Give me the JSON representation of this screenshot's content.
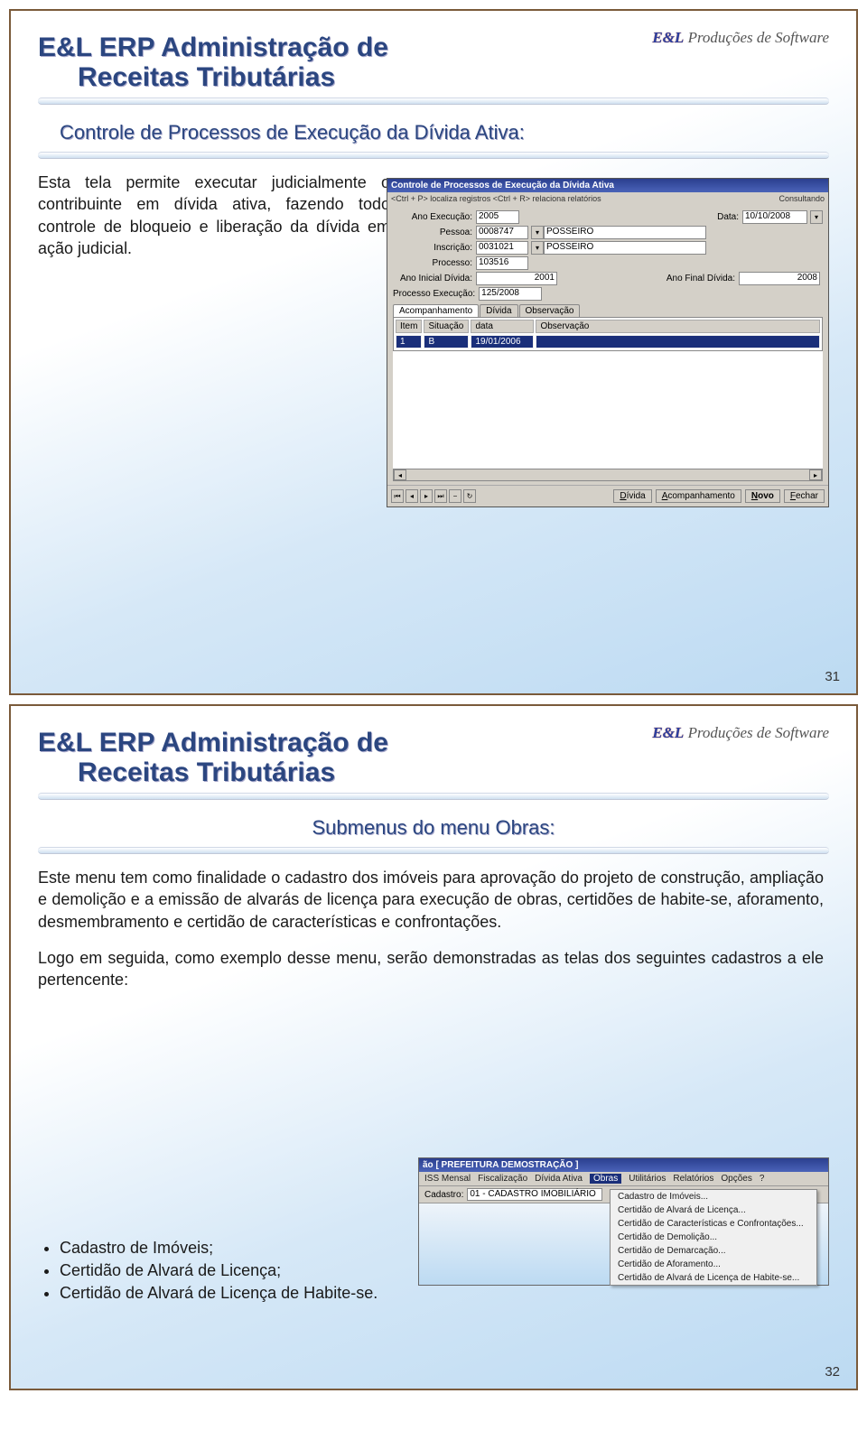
{
  "brand": {
    "el": "E&L",
    "tagline": "Produções de Software"
  },
  "slide1": {
    "title_l1": "E&L ERP Administração de",
    "title_l2": "Receitas Tributárias",
    "subtitle": "Controle de Processos de Execução da Dívida Ativa:",
    "body": "Esta tela permite executar judicialmente o contribuinte em dívida ativa, fazendo todo controle de bloqueio e liberação da dívida em ação judicial.",
    "page": "31"
  },
  "win": {
    "title": "Controle de Processos de Execução da Dívida Ativa",
    "hint_left": "<Ctrl + P> localiza registros  <Ctrl + R> relaciona relatórios",
    "hint_right": "Consultando",
    "labels": {
      "ano_exec": "Ano Execução:",
      "data": "Data:",
      "pessoa": "Pessoa:",
      "inscricao": "Inscrição:",
      "processo": "Processo:",
      "ano_ini": "Ano Inicial Dívida:",
      "ano_fim": "Ano Final Dívida:",
      "proc_exec": "Processo Execução:"
    },
    "vals": {
      "ano_exec": "2005",
      "data": "10/10/2008",
      "pessoa_cod": "0008747",
      "pessoa_nome": "POSSEIRO",
      "inscricao_cod": "0031021",
      "inscricao_nome": "POSSEIRO",
      "processo": "103516",
      "ano_ini": "2001",
      "ano_fim": "2008",
      "proc_exec": "125/2008"
    },
    "tabs": [
      "Acompanhamento",
      "Dívida",
      "Observação"
    ],
    "table": {
      "headers": [
        "Item",
        "Situação",
        "data",
        "Observação"
      ],
      "row": [
        "1",
        "B",
        "19/01/2006",
        ""
      ]
    },
    "buttons": {
      "divida": "Dívida",
      "acomp": "Acompanhamento",
      "novo": "Novo",
      "fechar": "Fechar"
    }
  },
  "slide2": {
    "title_l1": "E&L ERP Administração de",
    "title_l2": "Receitas Tributárias",
    "subtitle": "Submenus do menu Obras:",
    "body1": "Este menu tem como finalidade o cadastro dos imóveis para aprovação do projeto de construção, ampliação e demolição e a emissão de alvarás de licença para execução de obras, certidões de habite-se, aforamento, desmembramento e certidão de características e confrontações.",
    "body2": "Logo em seguida, como exemplo desse menu, serão demonstradas as telas dos seguintes cadastros a ele pertencente:",
    "bullets": [
      "Cadastro de Imóveis;",
      "Certidão de Alvará de Licença;",
      "Certidão de Alvará de Licença de Habite-se."
    ],
    "page": "32"
  },
  "menu": {
    "title": "ão  [ PREFEITURA DEMOSTRAÇÃO ]",
    "items": [
      "ISS Mensal",
      "Fiscalização",
      "Dívida Ativa",
      "Obras",
      "Utilitários",
      "Relatórios",
      "Opções",
      "?"
    ],
    "highlight": "Obras",
    "cad_label": "Cadastro:",
    "cad_value": "01 - CADASTRO IMOBILIÁRIO",
    "dropdown": [
      "Cadastro de Imóveis...",
      "Certidão de Alvará de Licença...",
      "Certidão de Características e Confrontações...",
      "Certidão de Demolição...",
      "Certidão de Demarcação...",
      "Certidão de Aforamento...",
      "Certidão de Alvará de Licença de Habite-se..."
    ]
  }
}
